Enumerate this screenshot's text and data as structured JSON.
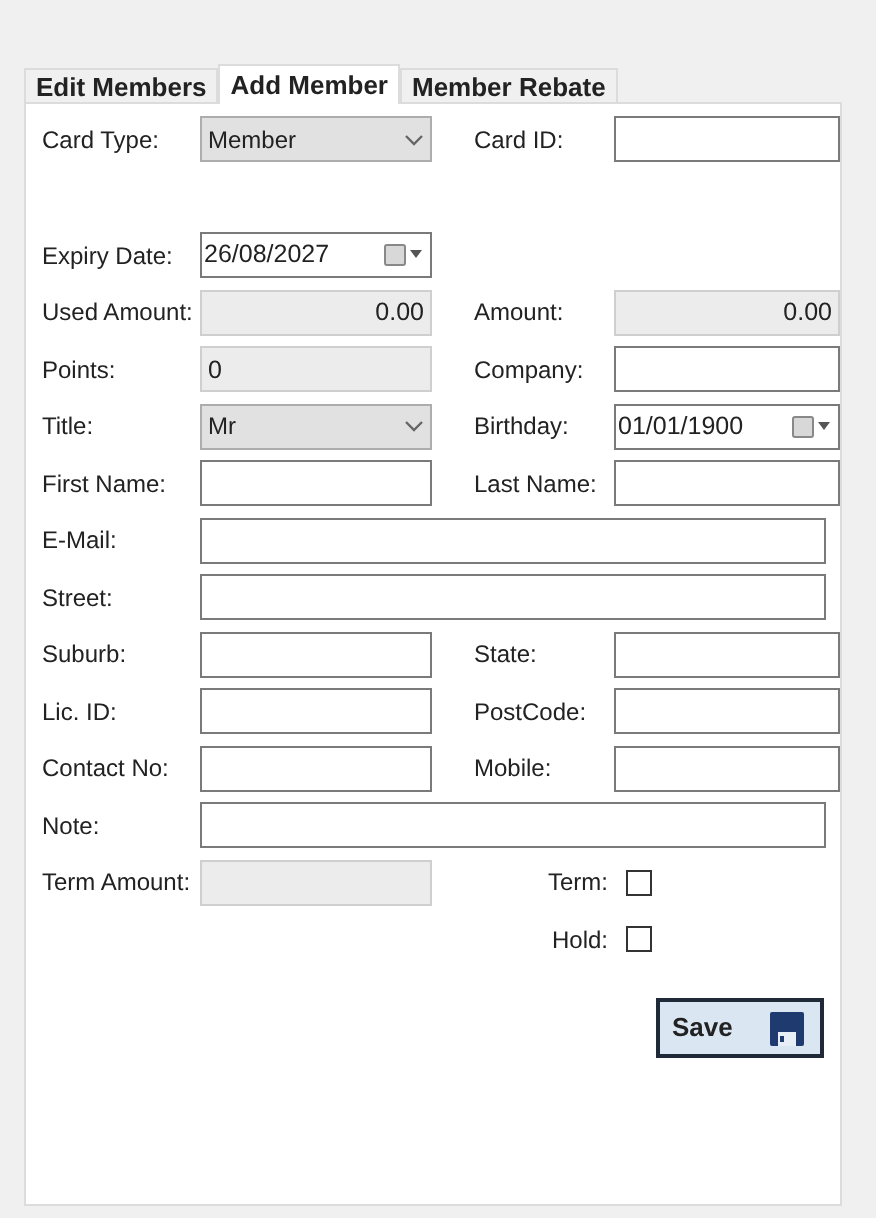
{
  "tabs": [
    {
      "label": "Edit Members",
      "selected": false
    },
    {
      "label": "Add Member",
      "selected": true
    },
    {
      "label": "Member Rebate",
      "selected": false
    }
  ],
  "rows": [
    {
      "cells": [
        {
          "label": "Card Type:",
          "kind": "combo",
          "value": "Member"
        },
        {
          "label": "Card ID:",
          "kind": "text",
          "disabled": false
        }
      ]
    },
    {
      "cells": [
        {
          "label": "Expiry Date:",
          "kind": "date",
          "value": "26/08/2027"
        }
      ]
    },
    {
      "cells": [
        {
          "label": "Used Amount:",
          "kind": "amount",
          "value": "0.00",
          "disabled": true
        },
        {
          "label": "Amount:",
          "kind": "amount",
          "value": "0.00",
          "disabled": true
        }
      ]
    },
    {
      "cells": [
        {
          "label": "Points:",
          "kind": "text",
          "value": "0",
          "disabled": true
        },
        {
          "label": "Company:",
          "kind": "text",
          "disabled": false
        }
      ]
    },
    {
      "cells": [
        {
          "label": "Title:",
          "kind": "combo",
          "value": "Mr"
        },
        {
          "label": "Birthday:",
          "kind": "date",
          "value": "01/01/1900"
        }
      ]
    },
    {
      "cells": [
        {
          "label": "First Name:",
          "kind": "text",
          "disabled": false
        },
        {
          "label": "Last Name:",
          "kind": "text",
          "disabled": false
        }
      ]
    },
    {
      "cells": [
        {
          "label": "E-Mail:",
          "kind": "long_text",
          "disabled": false
        }
      ]
    },
    {
      "cells": [
        {
          "label": "Street:",
          "kind": "long_text",
          "disabled": false
        }
      ]
    },
    {
      "cells": [
        {
          "label": "Suburb:",
          "kind": "text",
          "disabled": false
        },
        {
          "label": "State:",
          "kind": "text",
          "disabled": false
        }
      ]
    },
    {
      "cells": [
        {
          "label": "Lic. ID:",
          "kind": "text",
          "disabled": false
        },
        {
          "label": "PostCode:",
          "kind": "text",
          "disabled": false
        }
      ]
    },
    {
      "cells": [
        {
          "label": "Contact No:",
          "kind": "text",
          "disabled": false
        },
        {
          "label": "Mobile:",
          "kind": "text",
          "disabled": false
        }
      ]
    },
    {
      "cells": [
        {
          "label": "Note:",
          "kind": "long_text",
          "disabled": false
        }
      ]
    },
    {
      "cells": [
        {
          "label": "Term Amount:",
          "kind": "text",
          "disabled": true
        },
        {
          "label": "Term:",
          "kind": "checkbox",
          "checked": false
        }
      ]
    },
    {
      "cells": [
        {
          "kind": "empty"
        },
        {
          "label": "Hold:",
          "kind": "checkbox",
          "checked": false
        }
      ]
    }
  ],
  "save_button": {
    "label": "Save"
  }
}
